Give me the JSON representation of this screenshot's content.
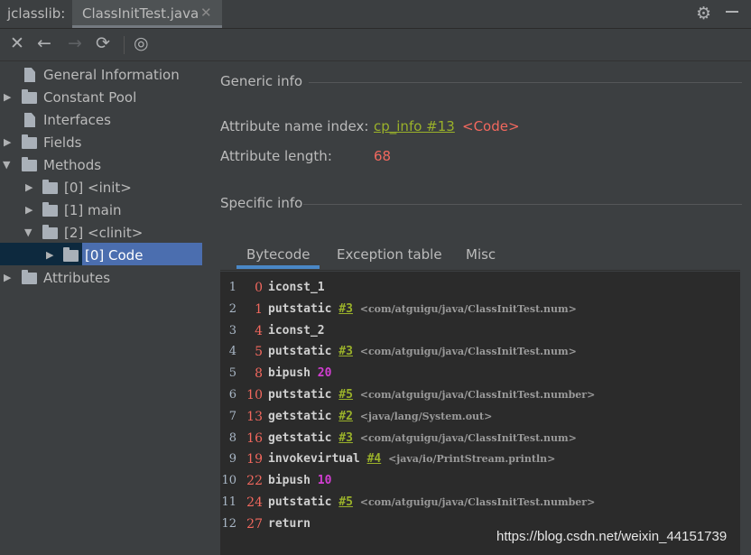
{
  "tool_window": {
    "title": "jclasslib:"
  },
  "file_tab": {
    "label": "ClassInitTest.java",
    "close": "✕"
  },
  "header_icons": {
    "settings": "⚙",
    "settings_icon": "gear-icon",
    "hide_icon": "minimize-icon"
  },
  "toolbar": {
    "close": "✕",
    "back": "←",
    "forward": "→",
    "refresh": "⟳",
    "browser": "◎"
  },
  "tree": {
    "general": "General Information",
    "constant_pool": "Constant Pool",
    "interfaces": "Interfaces",
    "fields": "Fields",
    "methods": "Methods",
    "m0": "[0] <init>",
    "m1": "[1] main",
    "m2": "[2] <clinit>",
    "m2_code": "[0] Code",
    "attributes": "Attributes"
  },
  "generic": {
    "heading": "Generic info",
    "name_index_label": "Attribute name index:",
    "name_index_link": "cp_info #13",
    "name_index_value": "<Code>",
    "length_label": "Attribute length:",
    "length_value": "68"
  },
  "specific": {
    "heading": "Specific info"
  },
  "subtabs": {
    "bytecode": "Bytecode",
    "exceptions": "Exception table",
    "misc": "Misc",
    "active": "Bytecode"
  },
  "bytecode": [
    {
      "line": "1",
      "offset": "0",
      "op": "iconst_1",
      "ref": "",
      "arg": "",
      "comment": ""
    },
    {
      "line": "2",
      "offset": "1",
      "op": "putstatic",
      "ref": "#3",
      "arg": "",
      "comment": "<com/atguigu/java/ClassInitTest.num>"
    },
    {
      "line": "3",
      "offset": "4",
      "op": "iconst_2",
      "ref": "",
      "arg": "",
      "comment": ""
    },
    {
      "line": "4",
      "offset": "5",
      "op": "putstatic",
      "ref": "#3",
      "arg": "",
      "comment": "<com/atguigu/java/ClassInitTest.num>"
    },
    {
      "line": "5",
      "offset": "8",
      "op": "bipush",
      "ref": "",
      "arg": "20",
      "comment": ""
    },
    {
      "line": "6",
      "offset": "10",
      "op": "putstatic",
      "ref": "#5",
      "arg": "",
      "comment": "<com/atguigu/java/ClassInitTest.number>"
    },
    {
      "line": "7",
      "offset": "13",
      "op": "getstatic",
      "ref": "#2",
      "arg": "",
      "comment": "<java/lang/System.out>"
    },
    {
      "line": "8",
      "offset": "16",
      "op": "getstatic",
      "ref": "#3",
      "arg": "",
      "comment": "<com/atguigu/java/ClassInitTest.num>"
    },
    {
      "line": "9",
      "offset": "19",
      "op": "invokevirtual",
      "ref": "#4",
      "arg": "",
      "comment": "<java/io/PrintStream.println>"
    },
    {
      "line": "10",
      "offset": "22",
      "op": "bipush",
      "ref": "",
      "arg": "10",
      "comment": ""
    },
    {
      "line": "11",
      "offset": "24",
      "op": "putstatic",
      "ref": "#5",
      "arg": "",
      "comment": "<com/atguigu/java/ClassInitTest.number>"
    },
    {
      "line": "12",
      "offset": "27",
      "op": "return",
      "ref": "",
      "arg": "",
      "comment": ""
    }
  ],
  "watermark": "https://blog.csdn.net/weixin_44151739",
  "colors": {
    "background": "#3c3f41",
    "selection": "#4b6eaf",
    "link": "#9ab12a",
    "value_red": "#f2685e",
    "number_magenta": "#d23ed2",
    "code_bg": "#2b2b2b"
  }
}
